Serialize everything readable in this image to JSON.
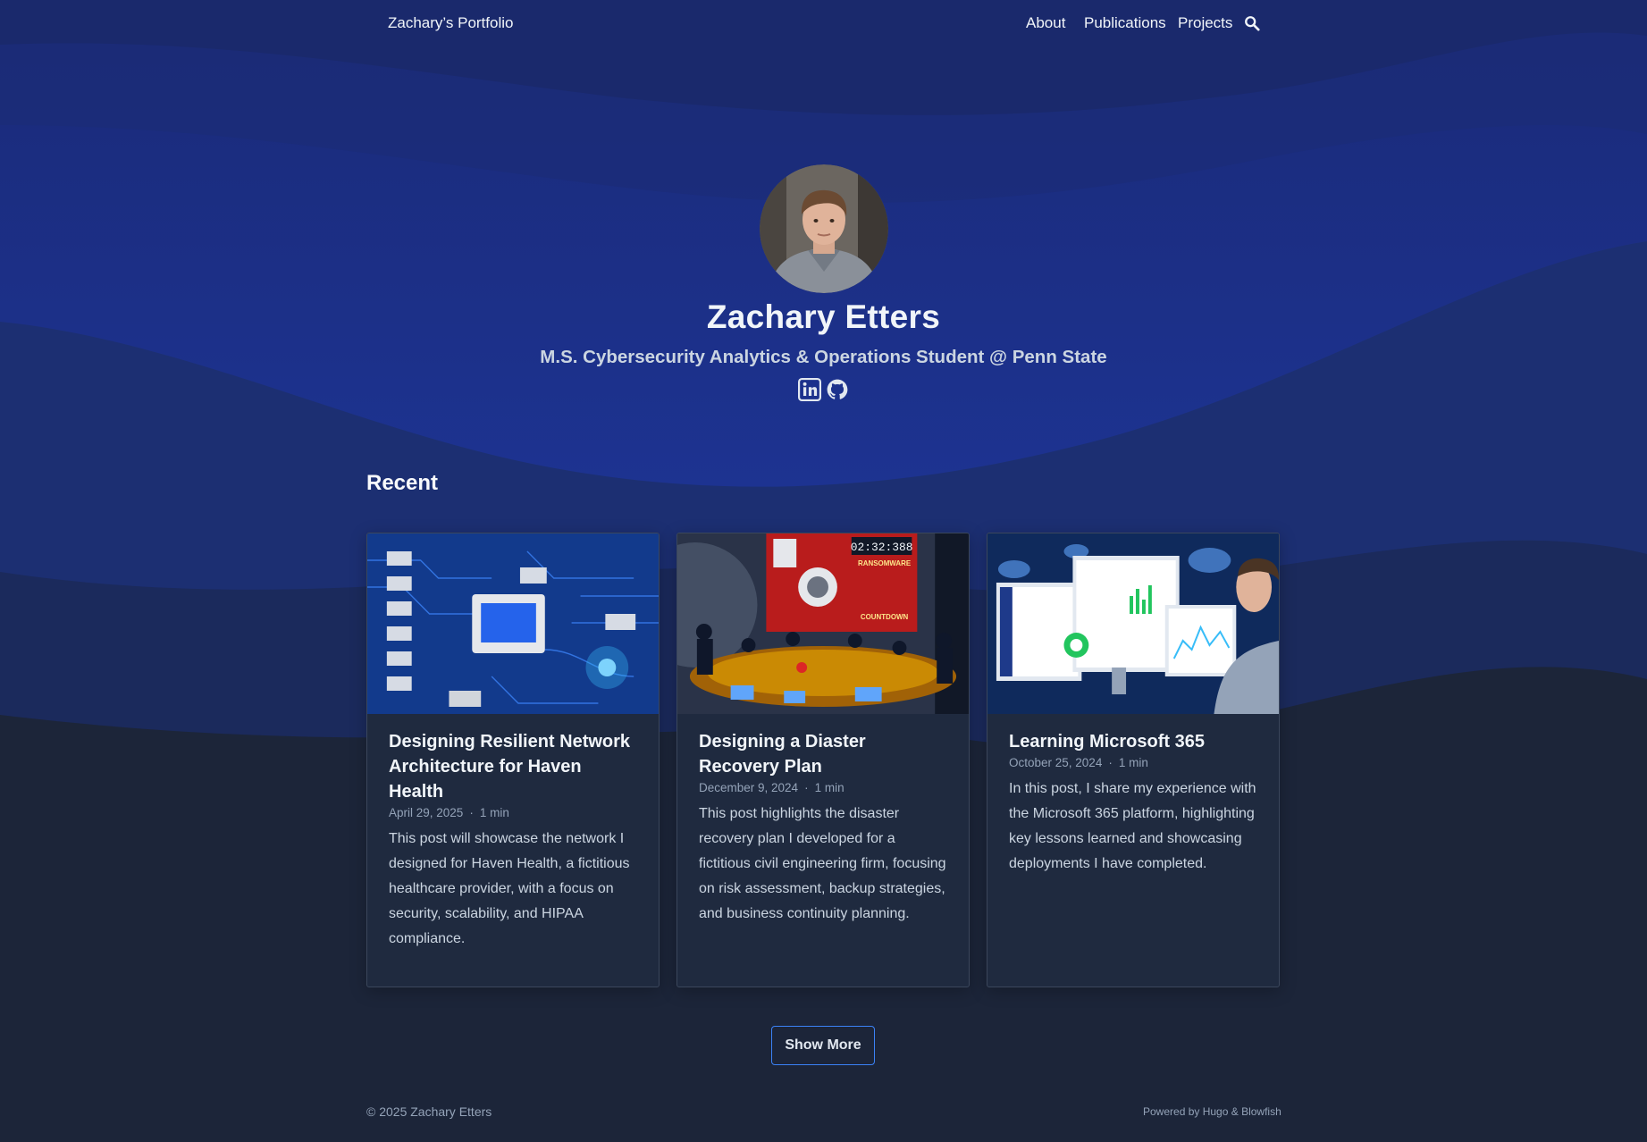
{
  "header": {
    "site_title": "Zachary’s Portfolio",
    "nav": [
      {
        "label": "About"
      },
      {
        "label": "Publications"
      },
      {
        "label": "Projects"
      }
    ],
    "search_icon": "search-icon"
  },
  "profile": {
    "name": "Zachary Etters",
    "headline": "M.S. Cybersecurity Analytics & Operations Student @ Penn State",
    "social": [
      {
        "icon": "linkedin-icon"
      },
      {
        "icon": "github-icon"
      }
    ]
  },
  "recent": {
    "heading": "Recent",
    "cards": [
      {
        "title": "Designing Resilient Network Architecture for Haven Health",
        "date": "April 29, 2025",
        "reading_time": "1 min",
        "summary": "This post will showcase the network I designed for Haven Health, a fictitious healthcare provider, with a focus on security, scalability, and HIPAA compliance."
      },
      {
        "title": "Designing a Diaster Recovery Plan",
        "date": "December 9, 2024",
        "reading_time": "1 min",
        "summary": "This post highlights the disaster recovery plan I developed for a fictitious civil engineering firm, focusing on risk assessment, backup strategies, and business continuity planning."
      },
      {
        "title": "Learning Microsoft 365",
        "date": "October 25, 2024",
        "reading_time": "1 min",
        "summary": "In this post, I share my experience with the Microsoft 365 platform, highlighting key lessons learned and showcasing deployments I have completed."
      }
    ],
    "show_more_label": "Show More",
    "thumb_text": {
      "timer": "02:32:388",
      "ransomware": "RANSOMWARE",
      "countdown": "COUNTDOWN"
    }
  },
  "footer": {
    "copyright": "© 2025 Zachary Etters",
    "powered_by": "Powered by Hugo & Blowfish"
  },
  "colors": {
    "page_background": "#1c2539",
    "hero_blue": "#1e3a8a",
    "accent": "#3b82f6",
    "card_background": "#1f2a3f"
  }
}
